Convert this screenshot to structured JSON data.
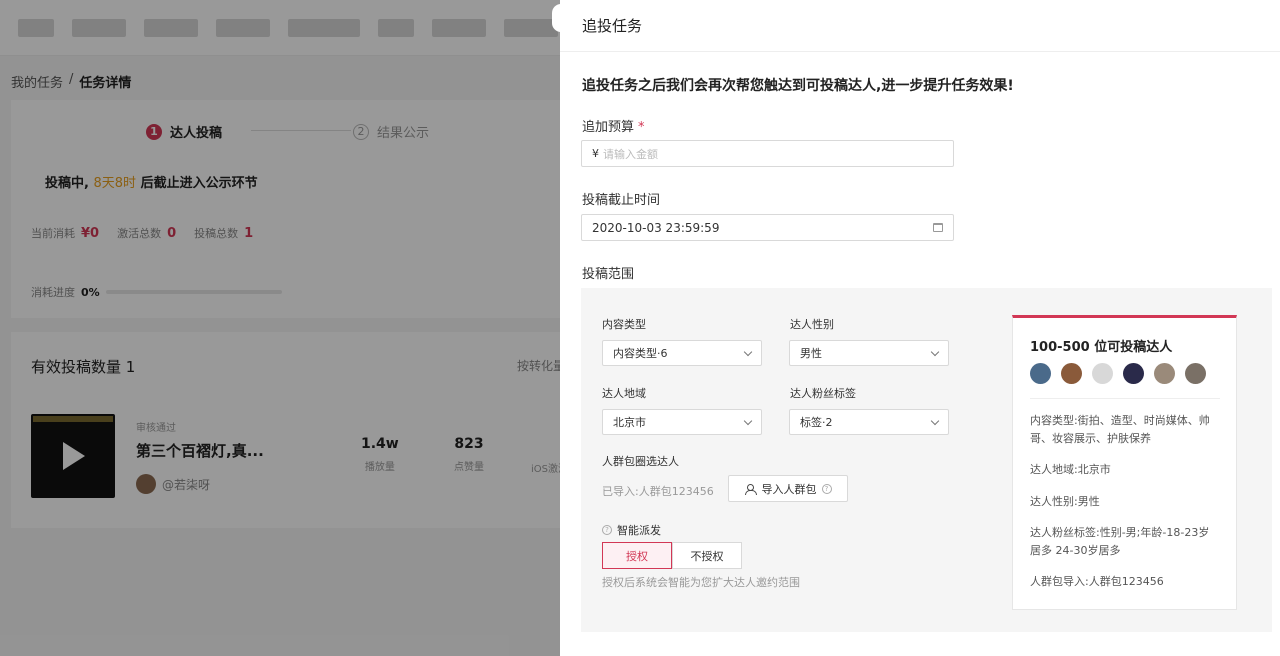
{
  "background": {
    "breadcrumb": {
      "root": "我的任务",
      "sep": "/",
      "current": "任务详情"
    },
    "steps": [
      {
        "num": "1",
        "label": "达人投稿"
      },
      {
        "num": "2",
        "label": "结果公示"
      }
    ],
    "status": {
      "prefix": "投稿中,",
      "highlight": "8天8时",
      "suffix": "后截止进入公示环节"
    },
    "stats": [
      {
        "label": "当前消耗",
        "value": "¥0"
      },
      {
        "label": "激活总数",
        "value": "0"
      },
      {
        "label": "投稿总数",
        "value": "1"
      }
    ],
    "progress": {
      "label": "消耗进度",
      "value": "0%"
    },
    "list": {
      "title": "有效投稿数量 1",
      "sort": "按转化量",
      "video": {
        "state": "审核通过",
        "title": "第三个百褶灯,真...",
        "author": "@若柒呀",
        "plays": "1.4w",
        "plays_label": "播放量",
        "likes": "823",
        "likes_label": "点赞量",
        "ios_label": "iOS激活"
      }
    }
  },
  "drawer": {
    "title": "追投任务",
    "intro": "追投任务之后我们会再次帮您触达到可投稿达人,进一步提升任务效果!",
    "budget": {
      "label": "追加预算",
      "required_mark": "*",
      "currency": "¥",
      "placeholder": "请输入金额"
    },
    "deadline": {
      "label": "投稿截止时间",
      "value": "2020-10-03 23:59:59"
    },
    "scope": {
      "label": "投稿范围",
      "content_type": {
        "label": "内容类型",
        "value": "内容类型·6"
      },
      "gender": {
        "label": "达人性别",
        "value": "男性"
      },
      "region": {
        "label": "达人地域",
        "value": "北京市"
      },
      "fan_tags": {
        "label": "达人粉丝标签",
        "value": "标签·2"
      },
      "crowd": {
        "label": "人群包圈选达人",
        "imported": "已导入:人群包123456",
        "import_button": "导入人群包"
      },
      "smart": {
        "label": "智能派发",
        "options": [
          "授权",
          "不授权"
        ],
        "selected": "授权",
        "hint": "授权后系统会智能为您扩大达人邀约范围"
      }
    },
    "summary": {
      "title": "100-500 位可投稿达人",
      "avatar_colors": [
        "#4a6a8a",
        "#8a5a3a",
        "#d8d8d8",
        "#2a2a4a",
        "#9a8a7a",
        "#7a7066"
      ],
      "rows": [
        "内容类型:街拍、造型、时尚媒体、帅哥、妆容展示、护肤保养",
        "达人地域:北京市",
        "达人性别:男性",
        "达人粉丝标签:性别-男;年龄-18-23岁居多 24-30岁居多",
        "人群包导入:人群包123456"
      ]
    },
    "accent": "#d23755"
  }
}
